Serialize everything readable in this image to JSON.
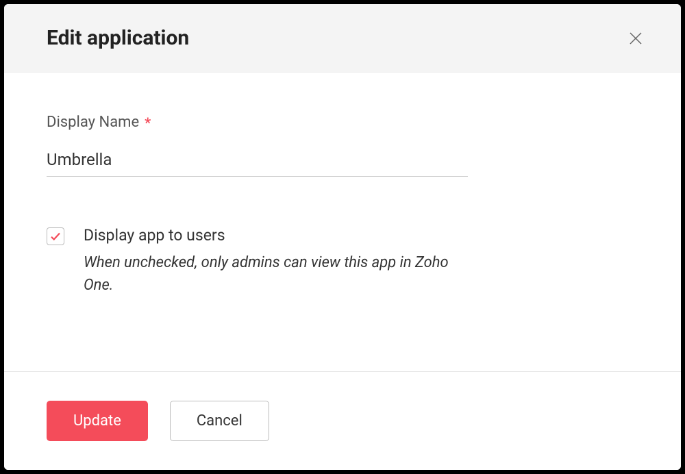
{
  "header": {
    "title": "Edit application"
  },
  "form": {
    "displayName": {
      "label": "Display Name",
      "required": true,
      "value": "Umbrella"
    },
    "displayToUsers": {
      "label": "Display app to users",
      "checked": true,
      "helper": "When unchecked, only admins can view this app in Zoho One."
    }
  },
  "footer": {
    "update_label": "Update",
    "cancel_label": "Cancel"
  }
}
